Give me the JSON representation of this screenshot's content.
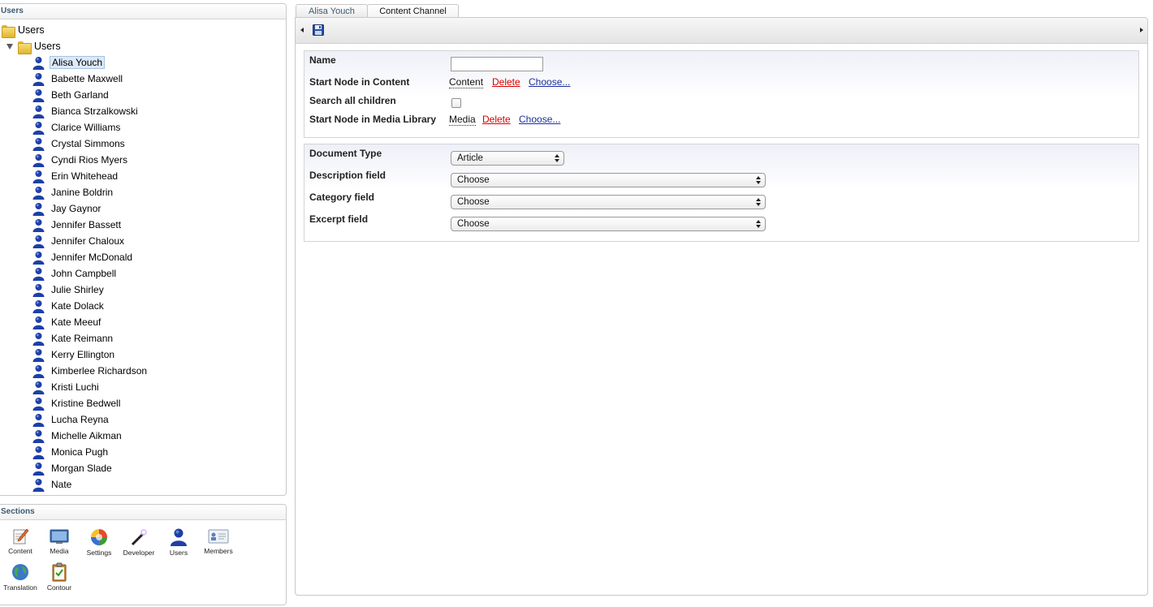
{
  "tree_panel": {
    "header": "Users",
    "root_label": "Users",
    "sub_label": "Users",
    "selected_index": 0,
    "users": [
      "Alisa Youch",
      "Babette Maxwell",
      "Beth Garland",
      "Bianca Strzalkowski",
      "Clarice Williams",
      "Crystal Simmons",
      "Cyndi Rios Myers",
      "Erin Whitehead",
      "Janine Boldrin",
      "Jay Gaynor",
      "Jennifer Bassett",
      "Jennifer Chaloux",
      "Jennifer McDonald",
      "John Campbell",
      "Julie Shirley",
      "Kate Dolack",
      "Kate Meeuf",
      "Kate Reimann",
      "Kerry Ellington",
      "Kimberlee Richardson",
      "Kristi Luchi",
      "Kristine Bedwell",
      "Lucha Reyna",
      "Michelle Aikman",
      "Monica Pugh",
      "Morgan Slade",
      "Nate"
    ]
  },
  "sections_panel": {
    "header": "Sections",
    "items": [
      {
        "label": "Content",
        "icon": "content-icon"
      },
      {
        "label": "Media",
        "icon": "media-icon"
      },
      {
        "label": "Settings",
        "icon": "settings-icon"
      },
      {
        "label": "Developer",
        "icon": "developer-icon"
      },
      {
        "label": "Users",
        "icon": "users-icon"
      },
      {
        "label": "Members",
        "icon": "members-icon"
      },
      {
        "label": "Translation",
        "icon": "translation-icon"
      },
      {
        "label": "Contour",
        "icon": "contour-icon"
      }
    ]
  },
  "tabs": [
    {
      "label": "Alisa Youch",
      "active": false
    },
    {
      "label": "Content Channel",
      "active": true
    }
  ],
  "toolbar": {
    "save_icon": "save-icon"
  },
  "channel_settings": {
    "name_label": "Name",
    "name_value": "",
    "start_content_label": "Start Node in Content",
    "start_content_value": "Content",
    "search_children_label": "Search all children",
    "search_children_checked": false,
    "start_media_label": "Start Node in Media Library",
    "start_media_value": "Media",
    "delete_label": "Delete",
    "choose_label": "Choose..."
  },
  "document_settings": {
    "doctype_label": "Document Type",
    "doctype_value": "Article",
    "description_label": "Description field",
    "description_value": "Choose",
    "category_label": "Category field",
    "category_value": "Choose",
    "excerpt_label": "Excerpt field",
    "excerpt_value": "Choose"
  },
  "colors": {
    "header_text": "#3c5a72",
    "delete_link": "#d40000",
    "choose_link": "#1c2e9c",
    "selection_bg": "#dde9f7"
  }
}
